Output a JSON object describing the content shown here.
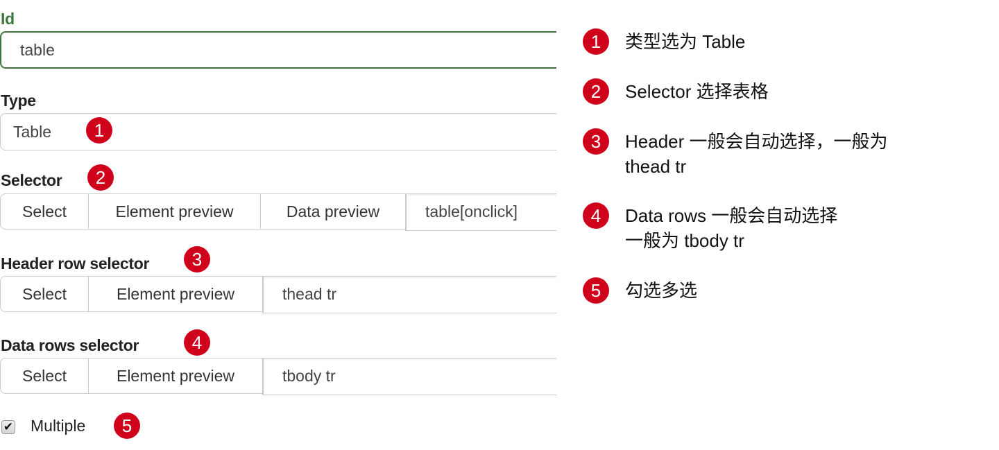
{
  "form": {
    "id": {
      "label": "Id",
      "value": "table"
    },
    "type": {
      "label": "Type",
      "value": "Table"
    },
    "selector": {
      "label": "Selector",
      "buttons": [
        "Select",
        "Element preview",
        "Data preview"
      ],
      "value": "table[onclick]"
    },
    "header_row_selector": {
      "label": "Header row selector",
      "buttons": [
        "Select",
        "Element preview"
      ],
      "value": "thead tr"
    },
    "data_rows_selector": {
      "label": "Data rows selector",
      "buttons": [
        "Select",
        "Element preview"
      ],
      "value": "tbody tr"
    },
    "multiple": {
      "label": "Multiple",
      "checked": true,
      "check_glyph": "✔"
    }
  },
  "badges": [
    "1",
    "2",
    "3",
    "4",
    "5"
  ],
  "notes": [
    {
      "number": "1",
      "lines": [
        "类型选为 Table"
      ]
    },
    {
      "number": "2",
      "lines": [
        "Selector 选择表格"
      ]
    },
    {
      "number": "3",
      "lines": [
        "Header 一般会自动选择，一般为",
        "thead tr"
      ]
    },
    {
      "number": "4",
      "lines": [
        "Data rows 一般会自动选择",
        "一般为 tbody tr"
      ]
    },
    {
      "number": "5",
      "lines": [
        "勾选多选"
      ]
    }
  ],
  "colors": {
    "badge": "#d0021b",
    "success": "#3c763d"
  }
}
